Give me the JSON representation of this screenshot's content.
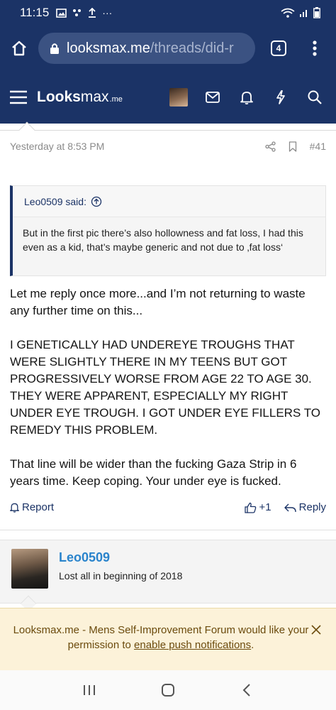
{
  "status_bar": {
    "time": "11:15",
    "more": "···"
  },
  "browser": {
    "url_host": "looksmax.me",
    "url_path": "/threads/did-r",
    "tab_count": "4"
  },
  "site": {
    "logo_main": "Looks",
    "logo_light": "max",
    "logo_suffix": ".me"
  },
  "post": {
    "timestamp": "Yesterday at 8:53 PM",
    "number": "#41",
    "quote": {
      "author_said": "Leo0509 said:",
      "text": "But in the first pic there’s also hollowness and fat loss, I had this even as a kid, that’s maybe generic and not due to ‚fat loss‘"
    },
    "paragraphs": [
      "Let me reply once more...and I’m not returning to waste any further time on this...",
      "I GENETICALLY HAD UNDEREYE TROUGHS THAT WERE SLIGHTLY THERE IN MY TEENS BUT GOT PROGRESSIVELY WORSE FROM AGE 22 TO AGE 30. THEY WERE APPARENT, ESPECIALLY MY RIGHT UNDER EYE TROUGH. I GOT UNDER EYE FILLERS TO REMEDY THIS PROBLEM.",
      "That line will be wider than the fucking Gaza Strip in 6 years time. Keep coping. Your under eye is fucked."
    ],
    "actions": {
      "report": "Report",
      "likes": "+1",
      "reply": "Reply"
    }
  },
  "next_post": {
    "username": "Leo0509",
    "user_title": "Lost all in beginning of 2018"
  },
  "notice": {
    "text_before": "Looksmax.me - Mens Self-Improvement Forum would like your permission to ",
    "link": "enable push notifications",
    "text_after": "."
  },
  "colors": {
    "header": "#1b3366",
    "link": "#2a84cc",
    "notice_bg": "#fcf2d9",
    "notice_text": "#6b4b0d"
  }
}
